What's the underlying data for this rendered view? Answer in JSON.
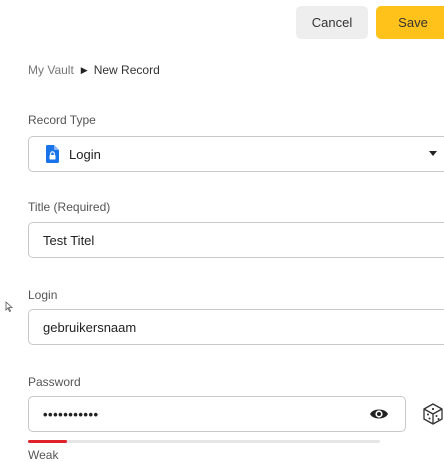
{
  "header": {
    "cancel_label": "Cancel",
    "save_label": "Save"
  },
  "breadcrumb": {
    "root": "My Vault",
    "separator": "▶",
    "current": "New Record"
  },
  "record_type": {
    "label": "Record Type",
    "value": "Login",
    "icon": "document-lock-icon"
  },
  "title": {
    "label": "Title (Required)",
    "value": "Test Titel"
  },
  "login": {
    "label": "Login",
    "value": "gebruikersnaam"
  },
  "password": {
    "label": "Password",
    "value": "•••••••••••",
    "strength_label": "Weak",
    "strength_fraction": 0.11
  },
  "colors": {
    "save_button": "#ffc21a",
    "cancel_button": "#eeeeee",
    "login_icon": "#1a73e8",
    "strength_weak": "#e0232b"
  }
}
